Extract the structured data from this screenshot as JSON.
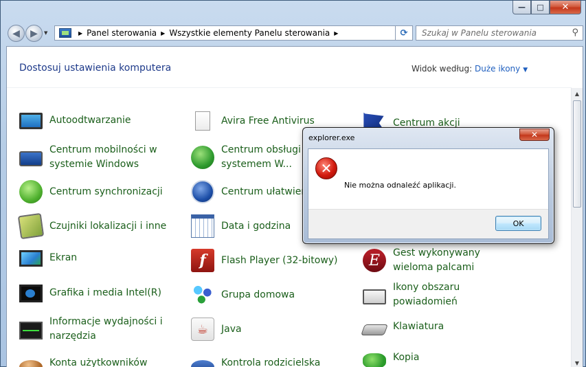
{
  "window": {
    "caption_buttons": {
      "minimize": "—",
      "maximize": "□",
      "close": "✕"
    }
  },
  "navbar": {
    "back_glyph": "◀",
    "forward_glyph": "▶",
    "breadcrumb": [
      "Panel sterowania",
      "Wszystkie elementy Panelu sterowania"
    ],
    "refresh_glyph": "⟳",
    "search_placeholder": "Szukaj w Panelu sterowania"
  },
  "header": {
    "title": "Dostosuj ustawienia komputera",
    "view_by_label": "Widok według:",
    "view_by_value": "Duże ikony"
  },
  "items": [
    {
      "label": "Autoodtwarzanie",
      "icon": "autoplay-icon"
    },
    {
      "label": "Avira Free Antivirus",
      "icon": "document-icon"
    },
    {
      "label": "Centrum akcji",
      "icon": "action-center-flag-icon"
    },
    {
      "label": "Centrum mobilności w systemie Windows",
      "icon": "mobility-center-icon"
    },
    {
      "label": "Centrum obsługi z systemem W...",
      "icon": "sync-center-globe-icon"
    },
    {
      "label": "Centrum synchronizacji",
      "icon": "sync-icon"
    },
    {
      "label": "Centrum ułatwień",
      "icon": "ease-of-access-icon"
    },
    {
      "label": "Czujniki lokalizacji i inne",
      "icon": "location-sensors-icon"
    },
    {
      "label": "Data i godzina",
      "icon": "calendar-clock-icon"
    },
    {
      "label": "Ekran",
      "icon": "display-icon"
    },
    {
      "label": "Flash Player (32-bitowy)",
      "icon": "flash-icon"
    },
    {
      "label": "Gest wykonywany wieloma palcami",
      "icon": "multitouch-gesture-icon"
    },
    {
      "label": "Grafika i media Intel(R)",
      "icon": "intel-graphics-icon"
    },
    {
      "label": "Grupa domowa",
      "icon": "homegroup-icon"
    },
    {
      "label": "Ikony obszaru powiadomień",
      "icon": "notification-tray-icon"
    },
    {
      "label": "Informacje wydajności i narzędzia",
      "icon": "performance-icon"
    },
    {
      "label": "Java",
      "icon": "java-icon"
    },
    {
      "label": "Klawiatura",
      "icon": "keyboard-icon"
    },
    {
      "label": "Konta użytkowników",
      "icon": "user-accounts-icon"
    },
    {
      "label": "Kontrola rodzicielska",
      "icon": "parental-controls-icon"
    },
    {
      "label": "Kopia",
      "icon": "backup-icon"
    }
  ],
  "dialog": {
    "title": "explorer.exe",
    "message": "Nie można odnaleźć aplikacji.",
    "ok_label": "OK",
    "close_glyph": "✕",
    "error_glyph": "✕"
  }
}
